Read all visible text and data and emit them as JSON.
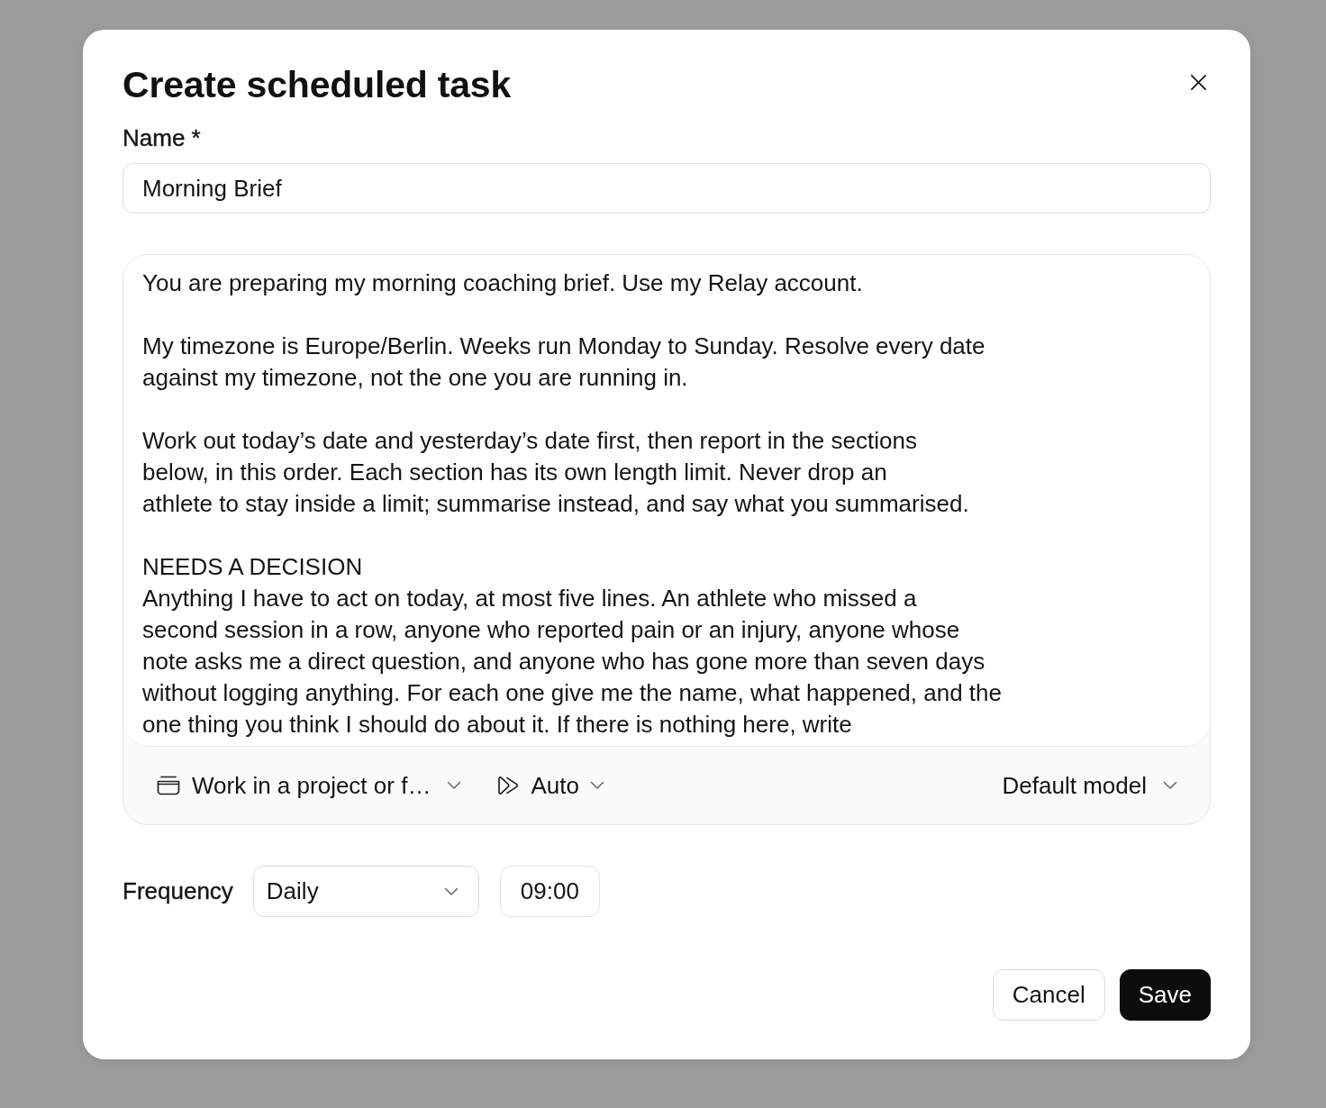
{
  "dialog": {
    "title": "Create scheduled task"
  },
  "name_field": {
    "label": "Name *",
    "value": "Morning Brief"
  },
  "prompt": {
    "paragraphs": [
      "You are preparing my morning coaching brief. Use my Relay account.",
      "My timezone is Europe/Berlin. Weeks run Monday to Sunday. Resolve every date\nagainst my timezone, not the one you are running in.",
      "Work out today’s date and yesterday’s date first, then report in the sections\nbelow, in this order. Each section has its own length limit. Never drop an\nathlete to stay inside a limit; summarise instead, and say what you summarised.",
      "NEEDS A DECISION\nAnything I have to act on today, at most five lines. An athlete who missed a\nsecond session in a row, anyone who reported pain or an injury, anyone whose\nnote asks me a direct question, and anyone who has gone more than seven days\nwithout logging anything. For each one give me the name, what happened, and the\none thing you think I should do about it. If there is nothing here, write"
    ],
    "toolbar": [
      {
        "kind": "folder",
        "label": "Work in a project or f…"
      },
      {
        "kind": "mode",
        "label": "Auto"
      },
      {
        "kind": "model",
        "label": "Default model"
      }
    ]
  },
  "frequency": {
    "label": "Frequency",
    "select": {
      "value": "Daily"
    },
    "time": {
      "value": "09:00"
    }
  },
  "buttons": [
    {
      "kind": "secondary",
      "label": "Cancel"
    },
    {
      "kind": "primary",
      "label": "Save"
    }
  ]
}
